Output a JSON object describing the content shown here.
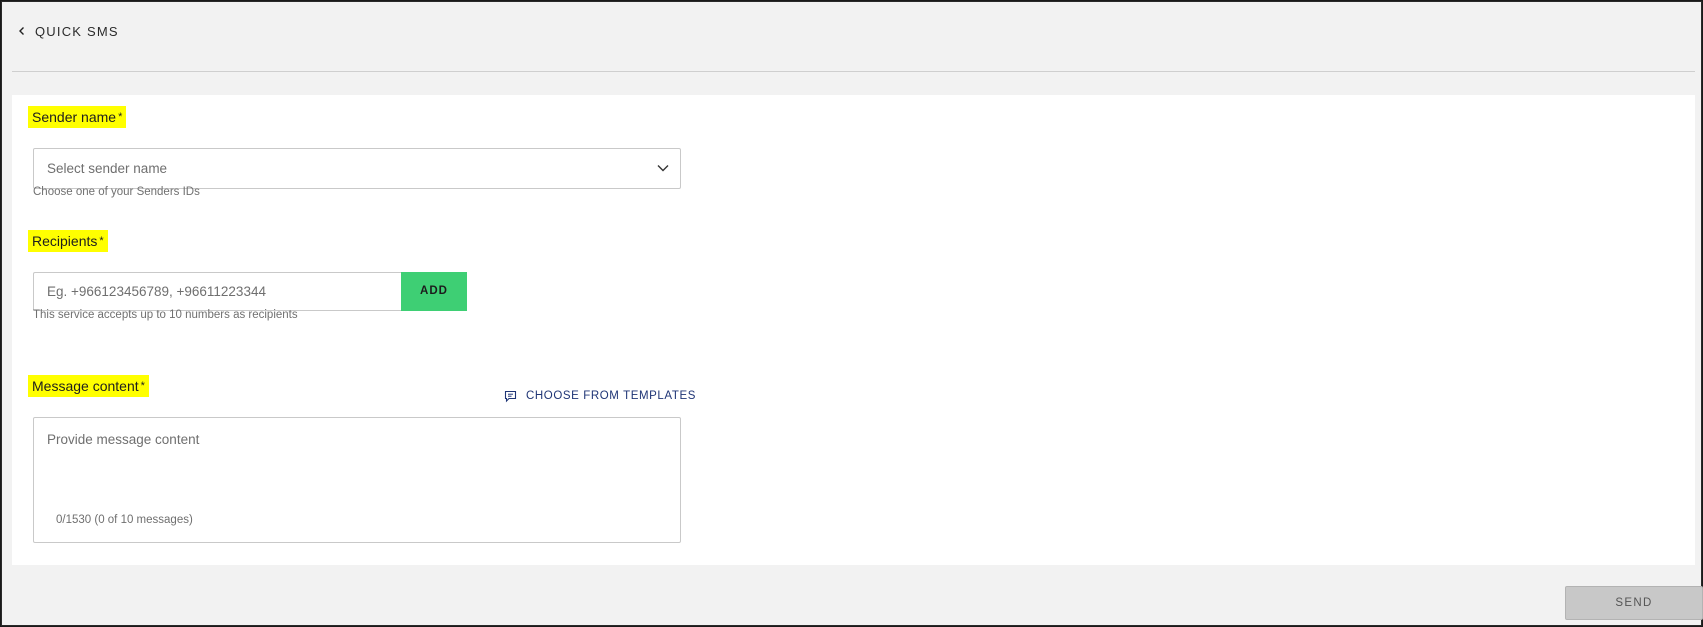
{
  "header": {
    "title": "QUICK SMS",
    "back_icon": "chevron-left-icon"
  },
  "sender": {
    "label": "Sender name",
    "required_mark": "*",
    "placeholder": "Select sender name",
    "helper": "Choose one of your Senders IDs"
  },
  "recipients": {
    "label": "Recipients",
    "required_mark": "*",
    "placeholder": "Eg. +966123456789, +96611223344",
    "add_label": "ADD",
    "helper": "This service accepts up to 10 numbers as recipients"
  },
  "message": {
    "label": "Message content",
    "required_mark": "*",
    "templates_label": "CHOOSE FROM TEMPLATES",
    "placeholder": "Provide message content",
    "counter": "0/1530 (0 of 10 messages)"
  },
  "footer": {
    "send_label": "SEND"
  },
  "colors": {
    "highlight": "#ffff00",
    "add_button": "#3ecf74",
    "link": "#1f3576",
    "send_disabled": "#c8c8c8"
  }
}
